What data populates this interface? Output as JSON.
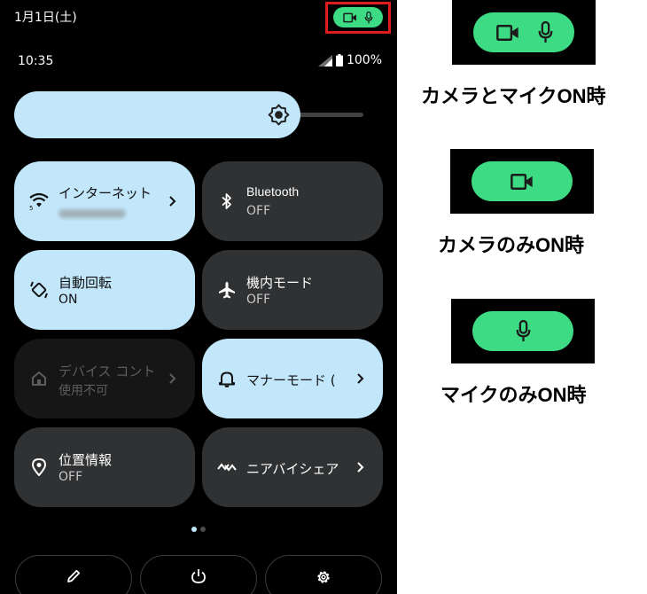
{
  "status_bar": {
    "date": "1月1日(土)",
    "time": "10:35",
    "battery": "100%"
  },
  "quick_settings": {
    "tiles": [
      {
        "title": "インターネット",
        "subtitle": "",
        "icon": "wifi-icon",
        "state": "on",
        "has_chevron": true
      },
      {
        "title": "Bluetooth",
        "subtitle": "OFF",
        "icon": "bluetooth-icon",
        "state": "off",
        "has_chevron": false
      },
      {
        "title": "自動回転",
        "subtitle": "ON",
        "icon": "auto-rotate-icon",
        "state": "on",
        "has_chevron": false
      },
      {
        "title": "機内モード",
        "subtitle": "OFF",
        "icon": "airplane-icon",
        "state": "off",
        "has_chevron": false
      },
      {
        "title": "デバイス コント",
        "subtitle": "使用不可",
        "icon": "home-icon",
        "state": "disabled",
        "has_chevron": true
      },
      {
        "title": "マナーモード (",
        "subtitle": "",
        "icon": "bell-icon",
        "state": "on",
        "has_chevron": true
      },
      {
        "title": "位置情報",
        "subtitle": "OFF",
        "icon": "location-icon",
        "state": "off",
        "has_chevron": false
      },
      {
        "title": "ニアバイシェア",
        "subtitle": "",
        "icon": "nearby-share-icon",
        "state": "off",
        "has_chevron": true
      }
    ],
    "page_indicator": {
      "current": 1,
      "total": 2
    }
  },
  "legend": [
    {
      "label": "カメラとマイクON時",
      "icons": [
        "camera-icon",
        "mic-icon"
      ]
    },
    {
      "label": "カメラのみON時",
      "icons": [
        "camera-icon"
      ]
    },
    {
      "label": "マイクのみON時",
      "icons": [
        "mic-icon"
      ]
    }
  ],
  "colors": {
    "privacy_green": "#3ddc84",
    "tile_on": "#c2e7fb",
    "tile_off": "#2f3133",
    "highlight_frame": "#e01c1c"
  }
}
